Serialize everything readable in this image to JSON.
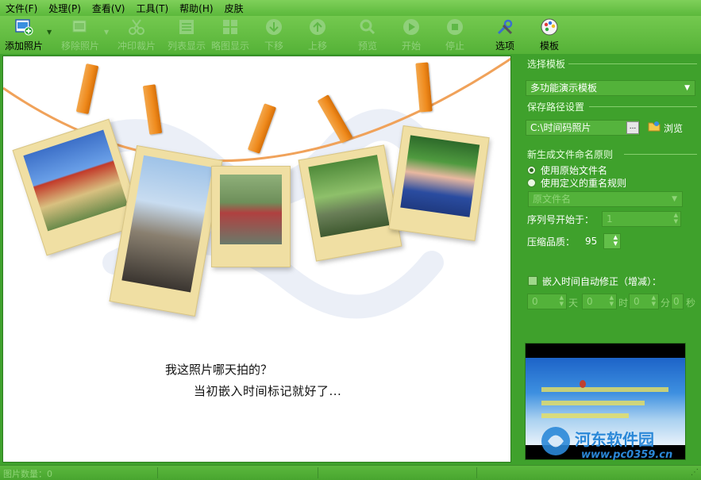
{
  "menu": {
    "file": "文件(F)",
    "process": "处理(P)",
    "view": "查看(V)",
    "tools": "工具(T)",
    "help": "帮助(H)",
    "skin": "皮肤"
  },
  "toolbar": {
    "add_photo": "添加照片",
    "remove_photo": "移除照片",
    "print_crop": "冲印裁片",
    "list_view": "列表显示",
    "thumb_view": "略图显示",
    "move_down": "下移",
    "move_up": "上移",
    "preview": "预览",
    "start": "开始",
    "stop": "停止",
    "options": "选项",
    "template": "模板"
  },
  "canvas": {
    "caption_line1": "我这照片哪天拍的？",
    "caption_line2": "当初嵌入时间标记就好了..."
  },
  "panel": {
    "template_group": "选择模板",
    "template_value": "多功能演示模板",
    "save_path_group": "保存路径设置",
    "save_path_value": "C:\\时间码照片",
    "browse_label": "浏览",
    "naming_group": "新生成文件命名原则",
    "radio_original": "使用原始文件名",
    "radio_custom": "使用定义的重名规则",
    "naming_select_value": "原文件名",
    "sequence_label": "序列号开始于：",
    "sequence_value": "1",
    "quality_label": "压缩品质：",
    "quality_value": "95",
    "auto_correct_label": "嵌入时间自动修正（增减）：",
    "correct_values": [
      "0",
      "0",
      "0",
      "0"
    ],
    "correct_units": [
      "天",
      "时",
      "分",
      "秒"
    ]
  },
  "status": {
    "text": "图片数量：0"
  },
  "watermark": {
    "site": "河东软件园",
    "url": "www.pc0359.cn"
  },
  "colors": {
    "accent_green": "#55b237",
    "clip_orange": "#ef8a1c",
    "photo_frame": "#f0dfa3"
  }
}
